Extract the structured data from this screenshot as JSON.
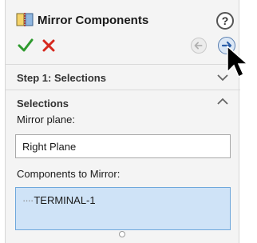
{
  "header": {
    "title": "Mirror Components",
    "help_label": "?"
  },
  "actions": {
    "ok": "check-icon",
    "cancel": "x-icon",
    "back": "arrow-left-icon",
    "next": "arrow-right-icon"
  },
  "step1": {
    "title": "Step 1: Selections",
    "state": "collapsed"
  },
  "selections": {
    "title": "Selections",
    "state": "expanded",
    "mirror_plane_label": "Mirror plane:",
    "mirror_plane_value": "Right Plane",
    "components_label": "Components to Mirror:",
    "components": [
      {
        "prefix": "····",
        "name": "TERMINAL-1"
      }
    ]
  },
  "colors": {
    "ok": "#2e9a2e",
    "cancel": "#d6281e",
    "list_bg": "#cfe3f7",
    "list_border": "#6fa8dc"
  }
}
